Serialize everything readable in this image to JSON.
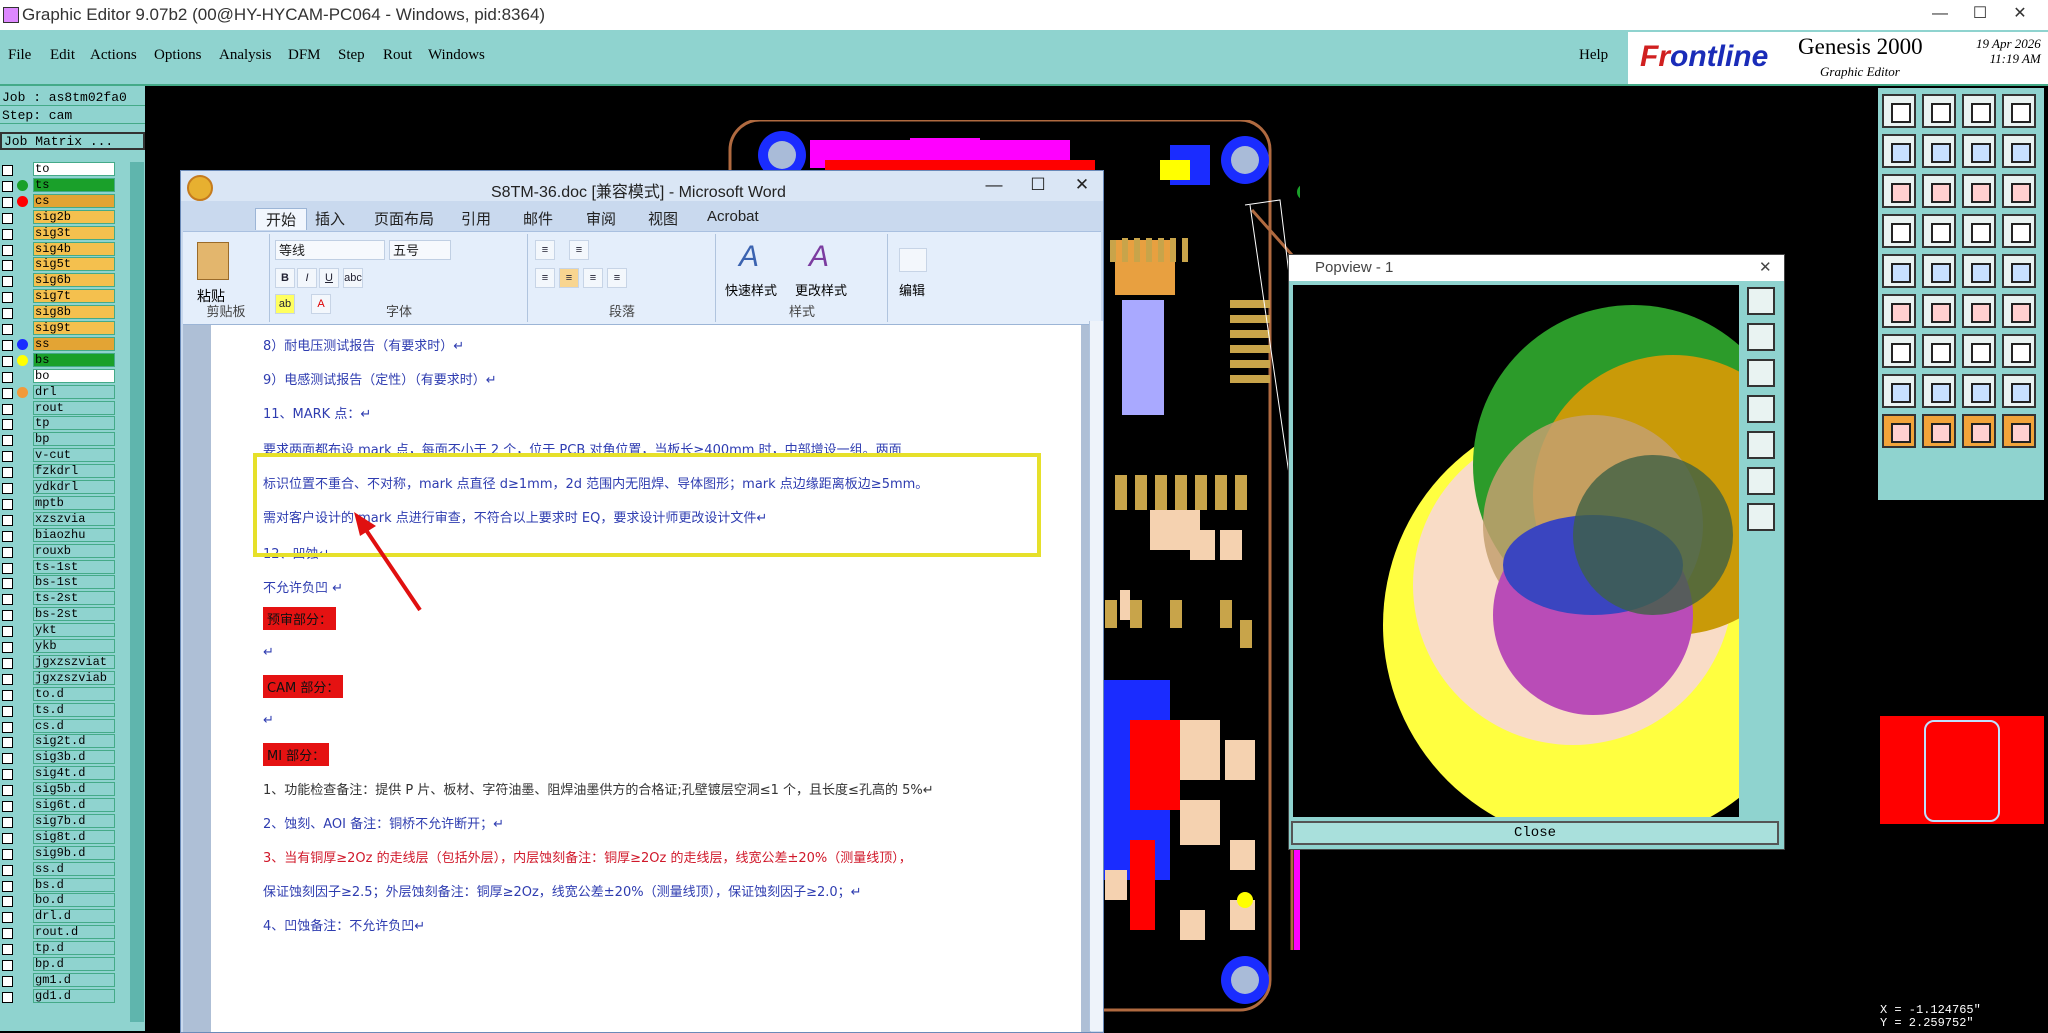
{
  "window": {
    "title": "Graphic Editor 9.07b2 (00@HY-HYCAM-PC064 - Windows, pid:8364)",
    "minimize": "—",
    "maximize": "☐",
    "close": "✕"
  },
  "menu": {
    "items": [
      "File",
      "Edit",
      "Actions",
      "Options",
      "Analysis",
      "DFM",
      "Step",
      "Rout",
      "Windows"
    ],
    "help": "Help"
  },
  "brand": {
    "frontline_a": "Fr",
    "frontline_b": "ontline",
    "product": "Genesis 2000",
    "subtitle": "Graphic Editor",
    "date": "19 Apr 2026",
    "time": "11:19 AM"
  },
  "job": {
    "job_label": "Job : as8tm02fa0",
    "step_label": "Step: cam",
    "matrix_label": "Job Matrix ..."
  },
  "layers": [
    {
      "name": "to",
      "color": "#ffffff",
      "dot": "",
      "bg": "#ffffff"
    },
    {
      "name": "ts",
      "color": "#ffffff",
      "dot": "#1aa02a",
      "bg": "#1aa02a"
    },
    {
      "name": "cs",
      "color": "#ffffff",
      "dot": "#ff0000",
      "bg": "#e3a434"
    },
    {
      "name": "sig2b",
      "color": "#ffffff",
      "dot": "",
      "bg": "#f4c04e"
    },
    {
      "name": "sig3t",
      "color": "#ffffff",
      "dot": "",
      "bg": "#f4c04e"
    },
    {
      "name": "sig4b",
      "color": "#ffffff",
      "dot": "",
      "bg": "#f4c04e"
    },
    {
      "name": "sig5t",
      "color": "#ffffff",
      "dot": "",
      "bg": "#f4c04e"
    },
    {
      "name": "sig6b",
      "color": "#ffffff",
      "dot": "",
      "bg": "#f4c04e"
    },
    {
      "name": "sig7t",
      "color": "#ffffff",
      "dot": "",
      "bg": "#f4c04e"
    },
    {
      "name": "sig8b",
      "color": "#ffffff",
      "dot": "",
      "bg": "#f4c04e"
    },
    {
      "name": "sig9t",
      "color": "#ffffff",
      "dot": "",
      "bg": "#f4c04e"
    },
    {
      "name": "ss",
      "color": "#ffffff",
      "dot": "#1a2cff",
      "bg": "#e3a434"
    },
    {
      "name": "bs",
      "color": "#ffffff",
      "dot": "#ffff00",
      "bg": "#1aa02a"
    },
    {
      "name": "bo",
      "color": "#ffffff",
      "dot": "",
      "bg": "#ffffff"
    },
    {
      "name": "drl",
      "color": "#ffffff",
      "dot": "#f29a3a",
      "bg": "#8fd3cf"
    },
    {
      "name": "rout",
      "color": "#ffffff",
      "dot": "",
      "bg": "#8fd3cf"
    },
    {
      "name": "tp",
      "color": "#ffffff",
      "dot": "",
      "bg": "#8fd3cf"
    },
    {
      "name": "bp",
      "color": "#ffffff",
      "dot": "",
      "bg": "#8fd3cf"
    },
    {
      "name": "v-cut",
      "color": "#ffffff",
      "dot": "",
      "bg": "#8fd3cf"
    },
    {
      "name": "fzkdrl",
      "color": "#ffffff",
      "dot": "",
      "bg": "#8fd3cf"
    },
    {
      "name": "ydkdrl",
      "color": "#ffffff",
      "dot": "",
      "bg": "#8fd3cf"
    },
    {
      "name": "mptb",
      "color": "#ffffff",
      "dot": "",
      "bg": "#8fd3cf"
    },
    {
      "name": "xzszvia",
      "color": "#ffffff",
      "dot": "",
      "bg": "#8fd3cf"
    },
    {
      "name": "biaozhu",
      "color": "#ffffff",
      "dot": "",
      "bg": "#8fd3cf"
    },
    {
      "name": "rouxb",
      "color": "#ffffff",
      "dot": "",
      "bg": "#8fd3cf"
    },
    {
      "name": "ts-1st",
      "color": "#ffffff",
      "dot": "",
      "bg": "#8fd3cf"
    },
    {
      "name": "bs-1st",
      "color": "#ffffff",
      "dot": "",
      "bg": "#8fd3cf"
    },
    {
      "name": "ts-2st",
      "color": "#ffffff",
      "dot": "",
      "bg": "#8fd3cf"
    },
    {
      "name": "bs-2st",
      "color": "#ffffff",
      "dot": "",
      "bg": "#8fd3cf"
    },
    {
      "name": "ykt",
      "color": "#ffffff",
      "dot": "",
      "bg": "#8fd3cf"
    },
    {
      "name": "ykb",
      "color": "#ffffff",
      "dot": "",
      "bg": "#8fd3cf"
    },
    {
      "name": "jgxzszviat",
      "color": "#ffffff",
      "dot": "",
      "bg": "#8fd3cf"
    },
    {
      "name": "jgxzszviab",
      "color": "#ffffff",
      "dot": "",
      "bg": "#8fd3cf"
    },
    {
      "name": "to.d",
      "color": "#ffffff",
      "dot": "",
      "bg": "#8fd3cf"
    },
    {
      "name": "ts.d",
      "color": "#ffffff",
      "dot": "",
      "bg": "#8fd3cf"
    },
    {
      "name": "cs.d",
      "color": "#ffffff",
      "dot": "",
      "bg": "#8fd3cf"
    },
    {
      "name": "sig2t.d",
      "color": "#ffffff",
      "dot": "",
      "bg": "#8fd3cf"
    },
    {
      "name": "sig3b.d",
      "color": "#ffffff",
      "dot": "",
      "bg": "#8fd3cf"
    },
    {
      "name": "sig4t.d",
      "color": "#ffffff",
      "dot": "",
      "bg": "#8fd3cf"
    },
    {
      "name": "sig5b.d",
      "color": "#ffffff",
      "dot": "",
      "bg": "#8fd3cf"
    },
    {
      "name": "sig6t.d",
      "color": "#ffffff",
      "dot": "",
      "bg": "#8fd3cf"
    },
    {
      "name": "sig7b.d",
      "color": "#ffffff",
      "dot": "",
      "bg": "#8fd3cf"
    },
    {
      "name": "sig8t.d",
      "color": "#ffffff",
      "dot": "",
      "bg": "#8fd3cf"
    },
    {
      "name": "sig9b.d",
      "color": "#ffffff",
      "dot": "",
      "bg": "#8fd3cf"
    },
    {
      "name": "ss.d",
      "color": "#ffffff",
      "dot": "",
      "bg": "#8fd3cf"
    },
    {
      "name": "bs.d",
      "color": "#ffffff",
      "dot": "",
      "bg": "#8fd3cf"
    },
    {
      "name": "bo.d",
      "color": "#ffffff",
      "dot": "",
      "bg": "#8fd3cf"
    },
    {
      "name": "drl.d",
      "color": "#ffffff",
      "dot": "",
      "bg": "#8fd3cf"
    },
    {
      "name": "rout.d",
      "color": "#ffffff",
      "dot": "",
      "bg": "#8fd3cf"
    },
    {
      "name": "tp.d",
      "color": "#ffffff",
      "dot": "",
      "bg": "#8fd3cf"
    },
    {
      "name": "bp.d",
      "color": "#ffffff",
      "dot": "",
      "bg": "#8fd3cf"
    },
    {
      "name": "gm1.d",
      "color": "#ffffff",
      "dot": "",
      "bg": "#8fd3cf"
    },
    {
      "name": "gd1.d",
      "color": "#ffffff",
      "dot": "",
      "bg": "#8fd3cf"
    }
  ],
  "coords": {
    "x": "X = -1.124765\"",
    "y": "Y = 2.259752\""
  },
  "popview": {
    "title": "Popview - 1",
    "close_label": "Close",
    "close_x": "✕"
  },
  "word": {
    "title": "S8TM-36.doc [兼容模式] - Microsoft Word",
    "tabs": [
      "开始",
      "插入",
      "页面布局",
      "引用",
      "邮件",
      "审阅",
      "视图",
      "Acrobat"
    ],
    "font_name": "等线",
    "font_size": "五号",
    "paste_label": "粘贴",
    "groups": [
      "剪贴板",
      "字体",
      "段落",
      "样式"
    ],
    "quick_style": "快速样式",
    "change_style": "更改样式",
    "edit_label": "编辑",
    "lines": [
      {
        "text": "8）耐电压测试报告（有要求时）↵",
        "cls": "blue"
      },
      {
        "text": "9）电感测试报告（定性）（有要求时）↵",
        "cls": "blue"
      },
      {
        "text": "11、MARK 点：↵",
        "cls": "blue"
      },
      {
        "text": "      要求两面都布设 mark 点，每面不小于 2 个，位于 PCB 对角位置，当板长≥400mm 时，中部增设一组。两面",
        "cls": "blue"
      },
      {
        "text": "标识位置不重合、不对称，mark 点直径 d≥1mm，2d 范围内无阻焊、导体图形；mark 点边缘距离板边≥5mm。",
        "cls": "blue"
      },
      {
        "text": "需对客户设计的 mark 点进行审查，不符合以上要求时 EQ，要求设计师更改设计文件↵",
        "cls": "blue"
      },
      {
        "text": "12、凹蚀↵",
        "cls": "blue"
      },
      {
        "text": " 不允许负凹 ↵",
        "cls": "blue"
      },
      {
        "text": "↵",
        "cls": "blue"
      },
      {
        "text": "↵",
        "cls": "blue"
      },
      {
        "text": "1、功能检查备注：提供 P 片、板材、字符油墨、阻焊油墨供方的合格证;孔壁镀层空洞≤1 个，且长度≤孔高的 5%↵",
        "cls": "gray"
      },
      {
        "text": "2、蚀刻、AOI 备注：铜桥不允许断开；↵",
        "cls": "blue"
      },
      {
        "text": "3、当有铜厚≥2Oz 的走线层（包括外层），内层蚀刻备注：铜厚≥2Oz 的走线层，线宽公差±20%（测量线顶），",
        "cls": "red"
      },
      {
        "text": "保证蚀刻因子≥2.5；外层蚀刻备注：铜厚≥2Oz，线宽公差±20%（测量线顶），保证蚀刻因子≥2.0；↵",
        "cls": "blue"
      },
      {
        "text": "4、凹蚀备注：不允许负凹↵",
        "cls": "blue"
      }
    ],
    "red_labels": [
      "预审部分：",
      "CAM 部分：",
      "MI 部分："
    ]
  }
}
